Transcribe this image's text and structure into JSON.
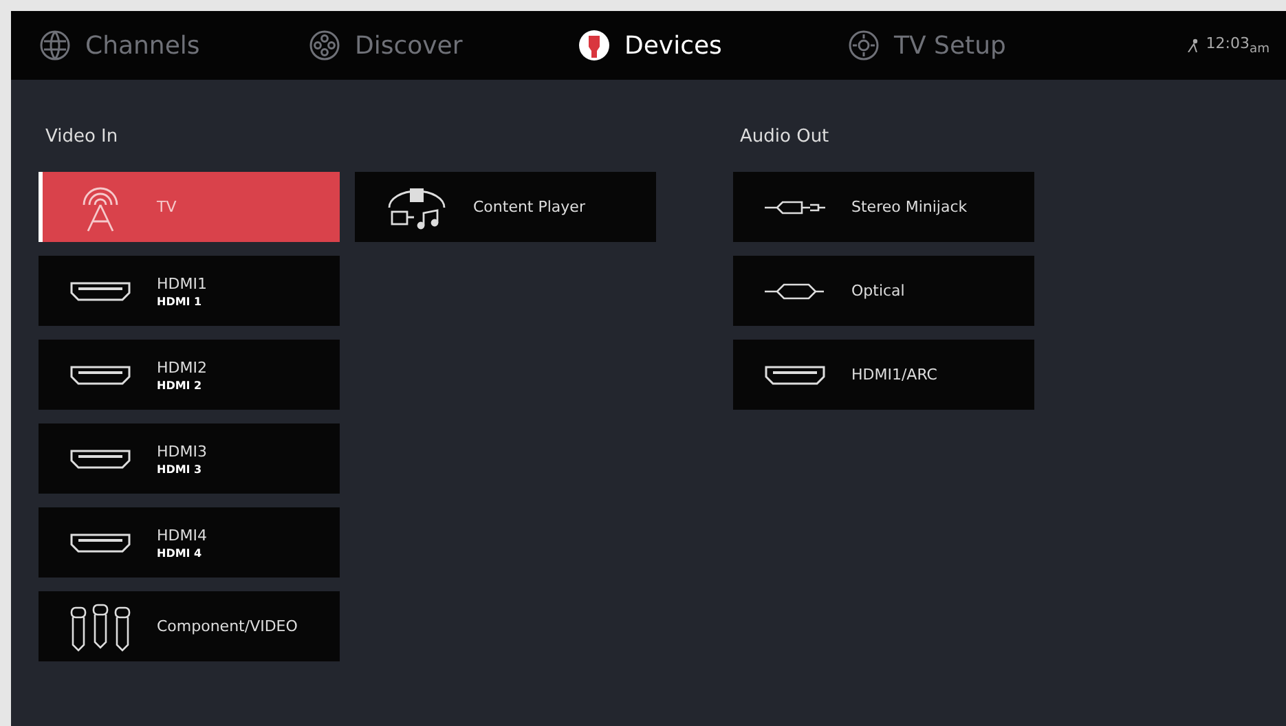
{
  "nav": {
    "tabs": [
      {
        "label": "Channels",
        "kind": "channels",
        "selected": false
      },
      {
        "label": "Discover",
        "kind": "discover",
        "selected": false
      },
      {
        "label": "Devices",
        "kind": "devices",
        "selected": true
      },
      {
        "label": "TV Setup",
        "kind": "setup",
        "selected": false
      }
    ],
    "clock": "12:03$_{am}$"
  },
  "video_in": {
    "title": "Video In",
    "columns": [
      [
        {
          "kind": "antenna",
          "label": "TV",
          "selected": true
        },
        {
          "kind": "hdmi",
          "label": "HDMI1",
          "sublabel": "HDMI 1",
          "selected": false
        },
        {
          "kind": "hdmi",
          "label": "HDMI2",
          "sublabel": "HDMI 2",
          "selected": false
        },
        {
          "kind": "hdmi",
          "label": "HDMI3",
          "sublabel": "HDMI 3",
          "selected": false
        },
        {
          "kind": "hdmi",
          "label": "HDMI4",
          "sublabel": "HDMI 4",
          "selected": false
        },
        {
          "kind": "component",
          "label": "Component/VIDEO",
          "selected": false
        }
      ],
      [
        {
          "kind": "media",
          "label": "Content Player",
          "selected": false
        }
      ]
    ]
  },
  "audio_out": {
    "title": "Audio Out",
    "items": [
      {
        "kind": "minijack",
        "label": "Stereo Minijack",
        "selected": false
      },
      {
        "kind": "optical",
        "label": "Optical",
        "selected": false
      },
      {
        "kind": "hdmi",
        "label": "HDMI1/ARC",
        "selected": false
      }
    ]
  }
}
